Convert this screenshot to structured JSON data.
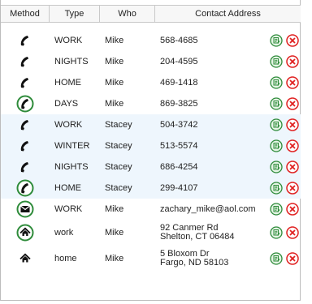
{
  "headers": {
    "method": "Method",
    "type": "Type",
    "who": "Who",
    "contact": "Contact Address"
  },
  "rows": [
    {
      "icon": "phone-icon",
      "type": "WORK",
      "who": "Mike",
      "address": "568-4685",
      "highlight": false
    },
    {
      "icon": "phone-icon",
      "type": "NIGHTS",
      "who": "Mike",
      "address": "204-4595",
      "highlight": false
    },
    {
      "icon": "phone-icon",
      "type": "HOME",
      "who": "Mike",
      "address": "469-1418",
      "highlight": false
    },
    {
      "icon": "phone-circle-icon",
      "type": "DAYS",
      "who": "Mike",
      "address": "869-3825",
      "highlight": false
    },
    {
      "icon": "phone-icon",
      "type": "WORK",
      "who": "Stacey",
      "address": "504-3742",
      "highlight": true
    },
    {
      "icon": "phone-icon",
      "type": "WINTER",
      "who": "Stacey",
      "address": "513-5574",
      "highlight": true
    },
    {
      "icon": "phone-icon",
      "type": "NIGHTS",
      "who": "Stacey",
      "address": "686-4254",
      "highlight": true
    },
    {
      "icon": "phone-circle-icon",
      "type": "HOME",
      "who": "Stacey",
      "address": "299-4107",
      "highlight": true
    },
    {
      "icon": "envelope-circle-icon",
      "type": "WORK",
      "who": "Mike",
      "address": "zachary_mike@aol.com",
      "highlight": false
    },
    {
      "icon": "home-circle-icon",
      "type": "work",
      "who": "Mike",
      "address": "92 Canmer Rd\nShelton, CT 06484",
      "highlight": false
    },
    {
      "icon": "home-icon",
      "type": "home",
      "who": "Mike",
      "address": "5 Bloxom Dr\nFargo, ND 58103",
      "highlight": false
    }
  ],
  "colors": {
    "accent_green": "#2e8b3a",
    "delete_red": "#e02020",
    "highlight_row": "#eef6fd"
  }
}
